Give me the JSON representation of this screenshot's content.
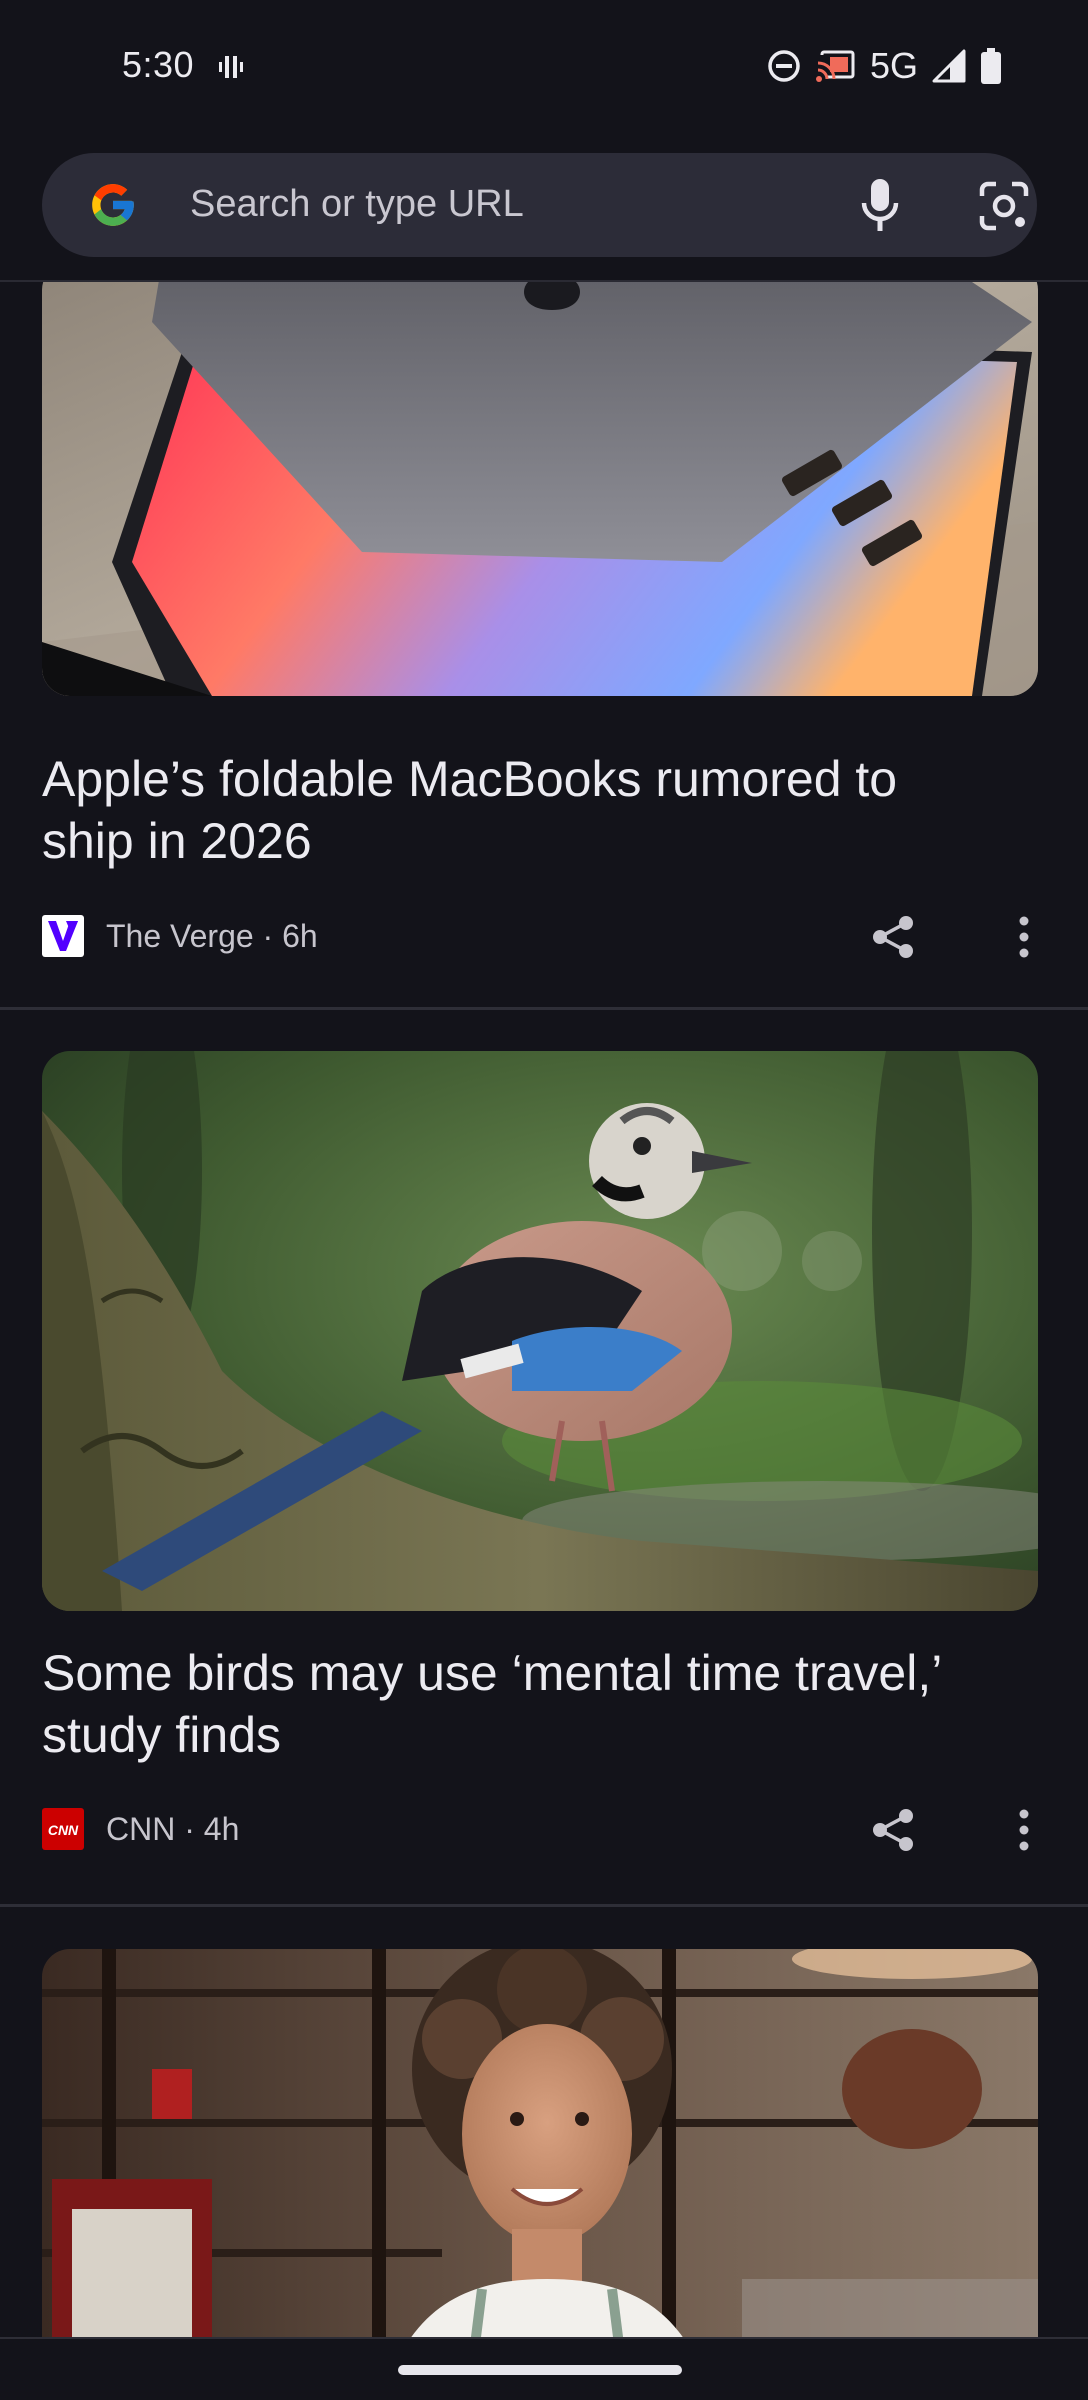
{
  "status_bar": {
    "time": "5:30",
    "network": "5G",
    "icons": [
      "vibrate-icon",
      "do-not-disturb-icon",
      "cast-icon",
      "signal-icon",
      "battery-icon"
    ]
  },
  "omnibox": {
    "placeholder": "Search or type URL",
    "icons": [
      "google-logo-icon",
      "microphone-icon",
      "lens-camera-icon"
    ]
  },
  "feed": {
    "cards": [
      {
        "title": "Apple’s foldable MacBooks rumored to ship in 2026",
        "source": "The Verge · 6h",
        "source_logo": "verge-logo",
        "image": "macbook-photo"
      },
      {
        "title": "Some birds may use ‘mental time travel,’ study finds",
        "source": "CNN · 4h",
        "source_logo": "cnn-logo",
        "image": "bird-photo"
      },
      {
        "image": "woman-cafe-photo"
      }
    ]
  },
  "colors": {
    "background": "#13131a",
    "omnibox": "#2c2c38",
    "text_primary": "#ecebf1",
    "text_secondary": "#c7c5cd",
    "verge_purple": "#5200ff",
    "cnn_red": "#cc0000"
  }
}
